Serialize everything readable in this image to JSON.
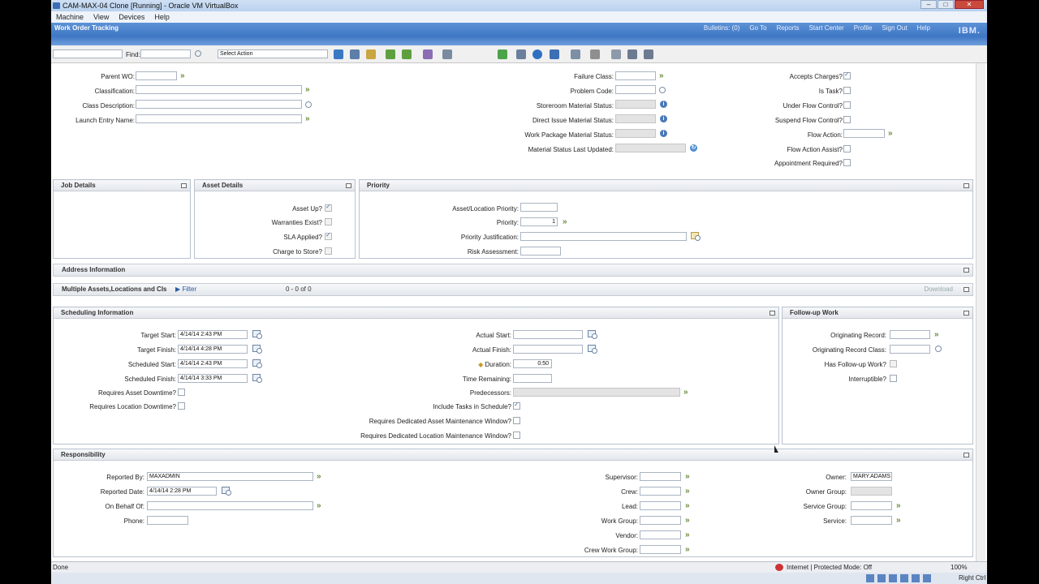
{
  "window": {
    "title": "CAM-MAX-04 Clone [Running] - Oracle VM VirtualBox",
    "min": "–",
    "max": "□",
    "close": "✕"
  },
  "menu": [
    "Machine",
    "View",
    "Devices",
    "Help"
  ],
  "app": {
    "title": "Work Order Tracking",
    "links": [
      "Bulletins: (0)",
      "Go To",
      "Reports",
      "Start Center",
      "Profile",
      "Sign Out",
      "Help"
    ],
    "logo": "IBM."
  },
  "toolbar": {
    "find_label": "Find:",
    "select_action": "Select Action"
  },
  "top": {
    "parent_wo": "Parent WO:",
    "classification": "Classification:",
    "class_description": "Class Description:",
    "launch_entry_name": "Launch Entry Name:",
    "failure_class": "Failure Class:",
    "problem_code": "Problem Code:",
    "storeroom_material_status": "Storeroom Material Status:",
    "direct_issue_material_status": "Direct Issue Material Status:",
    "work_package_material_status": "Work Package Material Status:",
    "material_status_last_updated": "Material Status Last Updated:",
    "accepts_charges": "Accepts Charges?",
    "is_task": "Is Task?",
    "under_flow_control": "Under Flow Control?",
    "suspend_flow_control": "Suspend Flow Control?",
    "flow_action": "Flow Action:",
    "flow_action_assist": "Flow Action Assist?",
    "appointment_required": "Appointment Required?"
  },
  "job_details": {
    "title": "Job Details"
  },
  "asset_details": {
    "title": "Asset Details",
    "asset_up": "Asset Up?",
    "warranties_exist": "Warranties Exist?",
    "sla_applied": "SLA Applied?",
    "charge_to_store": "Charge to Store?"
  },
  "priority": {
    "title": "Priority",
    "asset_location_priority": "Asset/Location Priority:",
    "priority_label": "Priority:",
    "priority_value": "1",
    "priority_justification": "Priority Justification:",
    "risk_assessment": "Risk Assessment:"
  },
  "address": {
    "title": "Address Information"
  },
  "multi": {
    "title": "Multiple Assets,Locations and CIs",
    "filter": "Filter",
    "count": "0 - 0 of 0",
    "download": "Download"
  },
  "scheduling": {
    "title": "Scheduling Information",
    "target_start": "Target Start:",
    "target_start_val": "4/14/14 2:43 PM",
    "target_finish": "Target Finish:",
    "target_finish_val": "4/14/14 4:28 PM",
    "scheduled_start": "Scheduled Start:",
    "scheduled_start_val": "4/14/14 2:43 PM",
    "scheduled_finish": "Scheduled Finish:",
    "scheduled_finish_val": "4/14/14 3:33 PM",
    "requires_asset_downtime": "Requires Asset Downtime?",
    "requires_location_downtime": "Requires Location Downtime?",
    "actual_start": "Actual Start:",
    "actual_finish": "Actual Finish:",
    "duration": "Duration:",
    "duration_val": "0:50",
    "time_remaining": "Time Remaining:",
    "predecessors": "Predecessors:",
    "include_tasks": "Include Tasks in Schedule?",
    "req_asset_window": "Requires Dedicated Asset Maintenance Window?",
    "req_location_window": "Requires Dedicated Location Maintenance Window?"
  },
  "followup": {
    "title": "Follow-up Work",
    "originating_record": "Originating Record:",
    "originating_record_class": "Originating Record Class:",
    "has_followup": "Has Follow-up Work?",
    "interruptible": "Interruptible?"
  },
  "responsibility": {
    "title": "Responsibility",
    "reported_by": "Reported By:",
    "reported_by_val": "MAXADMIN",
    "reported_date": "Reported Date:",
    "reported_date_val": "4/14/14 2:28 PM",
    "on_behalf_of": "On Behalf Of:",
    "phone": "Phone:",
    "supervisor": "Supervisor:",
    "crew": "Crew:",
    "lead": "Lead:",
    "work_group": "Work Group:",
    "vendor": "Vendor:",
    "crew_work_group": "Crew Work Group:",
    "owner": "Owner:",
    "owner_val": "MARY.ADAMS",
    "owner_group": "Owner Group:",
    "service_group": "Service Group:",
    "service": "Service:"
  },
  "status": {
    "left": "Done",
    "zone": "Internet | Protected Mode: Off",
    "zoom": "100%"
  },
  "taskbar": {
    "hostkey": "Right Ctrl"
  }
}
